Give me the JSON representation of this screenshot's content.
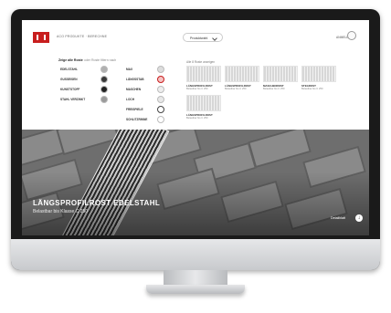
{
  "header": {
    "breadcrumb": "ACO PRODUKTE · BERECHNE",
    "product_select": "Produktwahl",
    "login_label": "ANMELDEN"
  },
  "config": {
    "heading_active": "Zeige alle Roste",
    "heading_inactive": "oder Roste filtern nach",
    "left_options": [
      {
        "label": "EDELSTAHL",
        "color": "#b0b0b0"
      },
      {
        "label": "GUSSEISEN",
        "color": "#3a3a3a"
      },
      {
        "label": "KUNSTSTOFF",
        "color": "#222222"
      },
      {
        "label": "STAHL VERZINKT",
        "color": "#9a9a9a"
      }
    ],
    "right_options": [
      {
        "label": "MAX",
        "color": "#dddddd"
      },
      {
        "label": "LÄNGSSTAB",
        "color": "#f4c4c4"
      },
      {
        "label": "MASCHEN",
        "color": "#eeeeee"
      },
      {
        "label": "LOCH",
        "color": "#e8e8e8"
      },
      {
        "label": "FREISPIELE",
        "color": "#ffffff"
      },
      {
        "label": "SCHLITZRINNE",
        "color": "#ffffff"
      }
    ],
    "result_note": "Alle 8 Roste anzeigen",
    "products": [
      {
        "title": "LÄNGSPROFILROST",
        "price": "Belastbar bis C 250"
      },
      {
        "title": "LÄNGSPROFILROST",
        "price": "Belastbar bis C 250"
      },
      {
        "title": "MASCHENROST",
        "price": "Belastbar bis C 250"
      },
      {
        "title": "STEGROST",
        "price": "Belastbar bis C 250"
      },
      {
        "title": "LÄNGSPROFILROST",
        "price": "Belastbar bis C 250"
      }
    ]
  },
  "hero": {
    "title": "LÄNGSPROFILROST EDELSTAHL",
    "subtitle": "Belastbar bis Klasse C 250",
    "detail_link": "Detailblatt"
  }
}
